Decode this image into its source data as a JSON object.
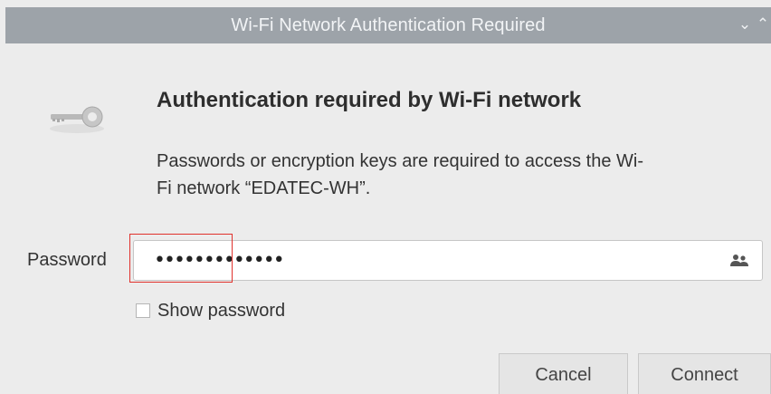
{
  "window": {
    "title": "Wi-Fi Network Authentication Required",
    "controls": {
      "minimize": "⌄",
      "maximize": "⌃",
      "close": "×"
    }
  },
  "dialog": {
    "heading": "Authentication required by Wi-Fi network",
    "message_line1": "Passwords or encryption keys are required to access the Wi-",
    "message_line2": "Fi network “EDATEC-WH”."
  },
  "password": {
    "label": "Password",
    "value_masked": "•••••••••••••",
    "icon": "people-icon"
  },
  "show_password": {
    "label": "Show password",
    "checked": false
  },
  "buttons": {
    "cancel": "Cancel",
    "connect": "Connect"
  },
  "highlight_color": "#e0312c"
}
